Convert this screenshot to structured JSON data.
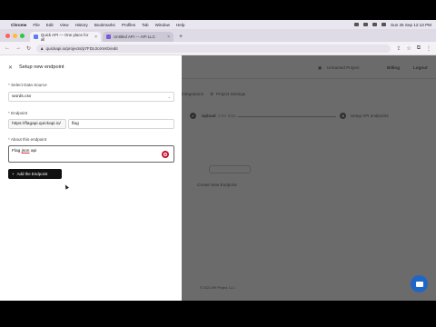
{
  "menubar": {
    "app": "Chrome",
    "items": [
      "File",
      "Edit",
      "View",
      "History",
      "Bookmarks",
      "Profiles",
      "Tab",
      "Window",
      "Help"
    ],
    "clock": "Sun 25 Sep  12:13 PM"
  },
  "browser": {
    "tabs": [
      {
        "title": "Quick API — One place for all"
      },
      {
        "title": "Untitled API — API LLC"
      }
    ],
    "url": "quickapi.io/projects/p7FDL0oXnKb/edit"
  },
  "panel": {
    "title": "Setup new endpoint",
    "data_source_label": "Select Data Source",
    "data_source_value": "words.csv",
    "endpoint_label": "Endpoint",
    "endpoint_base": "https://flagapi.quickapi.io/",
    "endpoint_path": "flag",
    "about_label": "About this endpoint",
    "about_text_before": "Flag ",
    "about_text_typo": "json",
    "about_text_after": " api",
    "add_button": "Add the Endpoint"
  },
  "background_app": {
    "top_right_text": "Unnamed Project",
    "billing": "Billing",
    "logout": "Logout",
    "nav_integrations": "Integrations",
    "nav_project_settings": "Project Settings",
    "step1_label": "Upload",
    "step1_sub": "CSV data",
    "step3_num": "3",
    "step3_label": "Setup API endpoints",
    "empty_state_link": "Create New Endpoint",
    "footer": "© 2022 API Project, LLC"
  }
}
